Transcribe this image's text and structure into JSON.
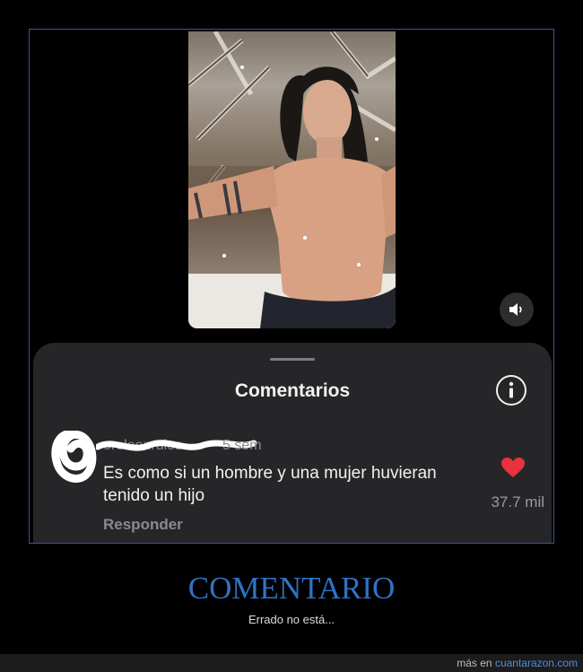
{
  "comments_sheet": {
    "title": "Comentarios",
    "comment": {
      "username": "oreleonrulos",
      "time": "5 sem",
      "text": "Es como si un hombre y una mujer huvieran tenido un hijo",
      "reply_label": "Responder",
      "likes": "37.7 mil"
    }
  },
  "caption": {
    "title": "COMENTARIO",
    "subtitle": "Errado no está..."
  },
  "footer": {
    "prefix": "más en",
    "site": "cuantarazon.com"
  },
  "colors": {
    "heart": "#e8323f",
    "caption": "#2f73c4",
    "link": "#4f8fe0"
  },
  "icons": [
    "volume-icon",
    "info-icon",
    "heart-icon"
  ]
}
